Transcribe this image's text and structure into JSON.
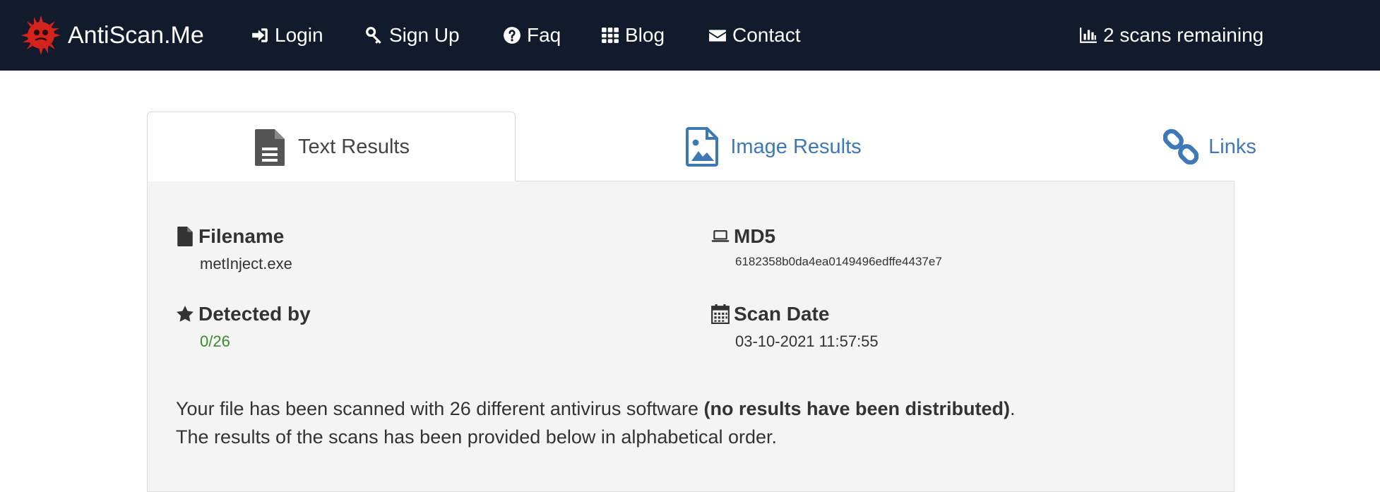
{
  "nav": {
    "brand": "AntiScan.Me",
    "login": "Login",
    "signup": "Sign Up",
    "faq": "Faq",
    "blog": "Blog",
    "contact": "Contact",
    "scans_remaining": "2 scans remaining"
  },
  "tabs": {
    "text_results": "Text Results",
    "image_results": "Image Results",
    "links": "Links",
    "active": "text_results"
  },
  "file": {
    "filename_label": "Filename",
    "filename": "metInject.exe",
    "md5_label": "MD5",
    "md5": "6182358b0da4ea0149496edffe4437e7",
    "detected_label": "Detected by",
    "detected": "0/26",
    "scandate_label": "Scan Date",
    "scandate": "03-10-2021 11:57:55"
  },
  "summary": {
    "line1_pre": "Your file has been scanned with 26 different antivirus software ",
    "line1_bold": "(no results have been distributed)",
    "line1_post": ".",
    "line2": "The results of the scans has been provided below in alphabetical order."
  },
  "colors": {
    "navbar": "#111b2b",
    "link": "#3f79b5",
    "detected": "#3a8a2a",
    "panel": "#f4f4f4"
  }
}
